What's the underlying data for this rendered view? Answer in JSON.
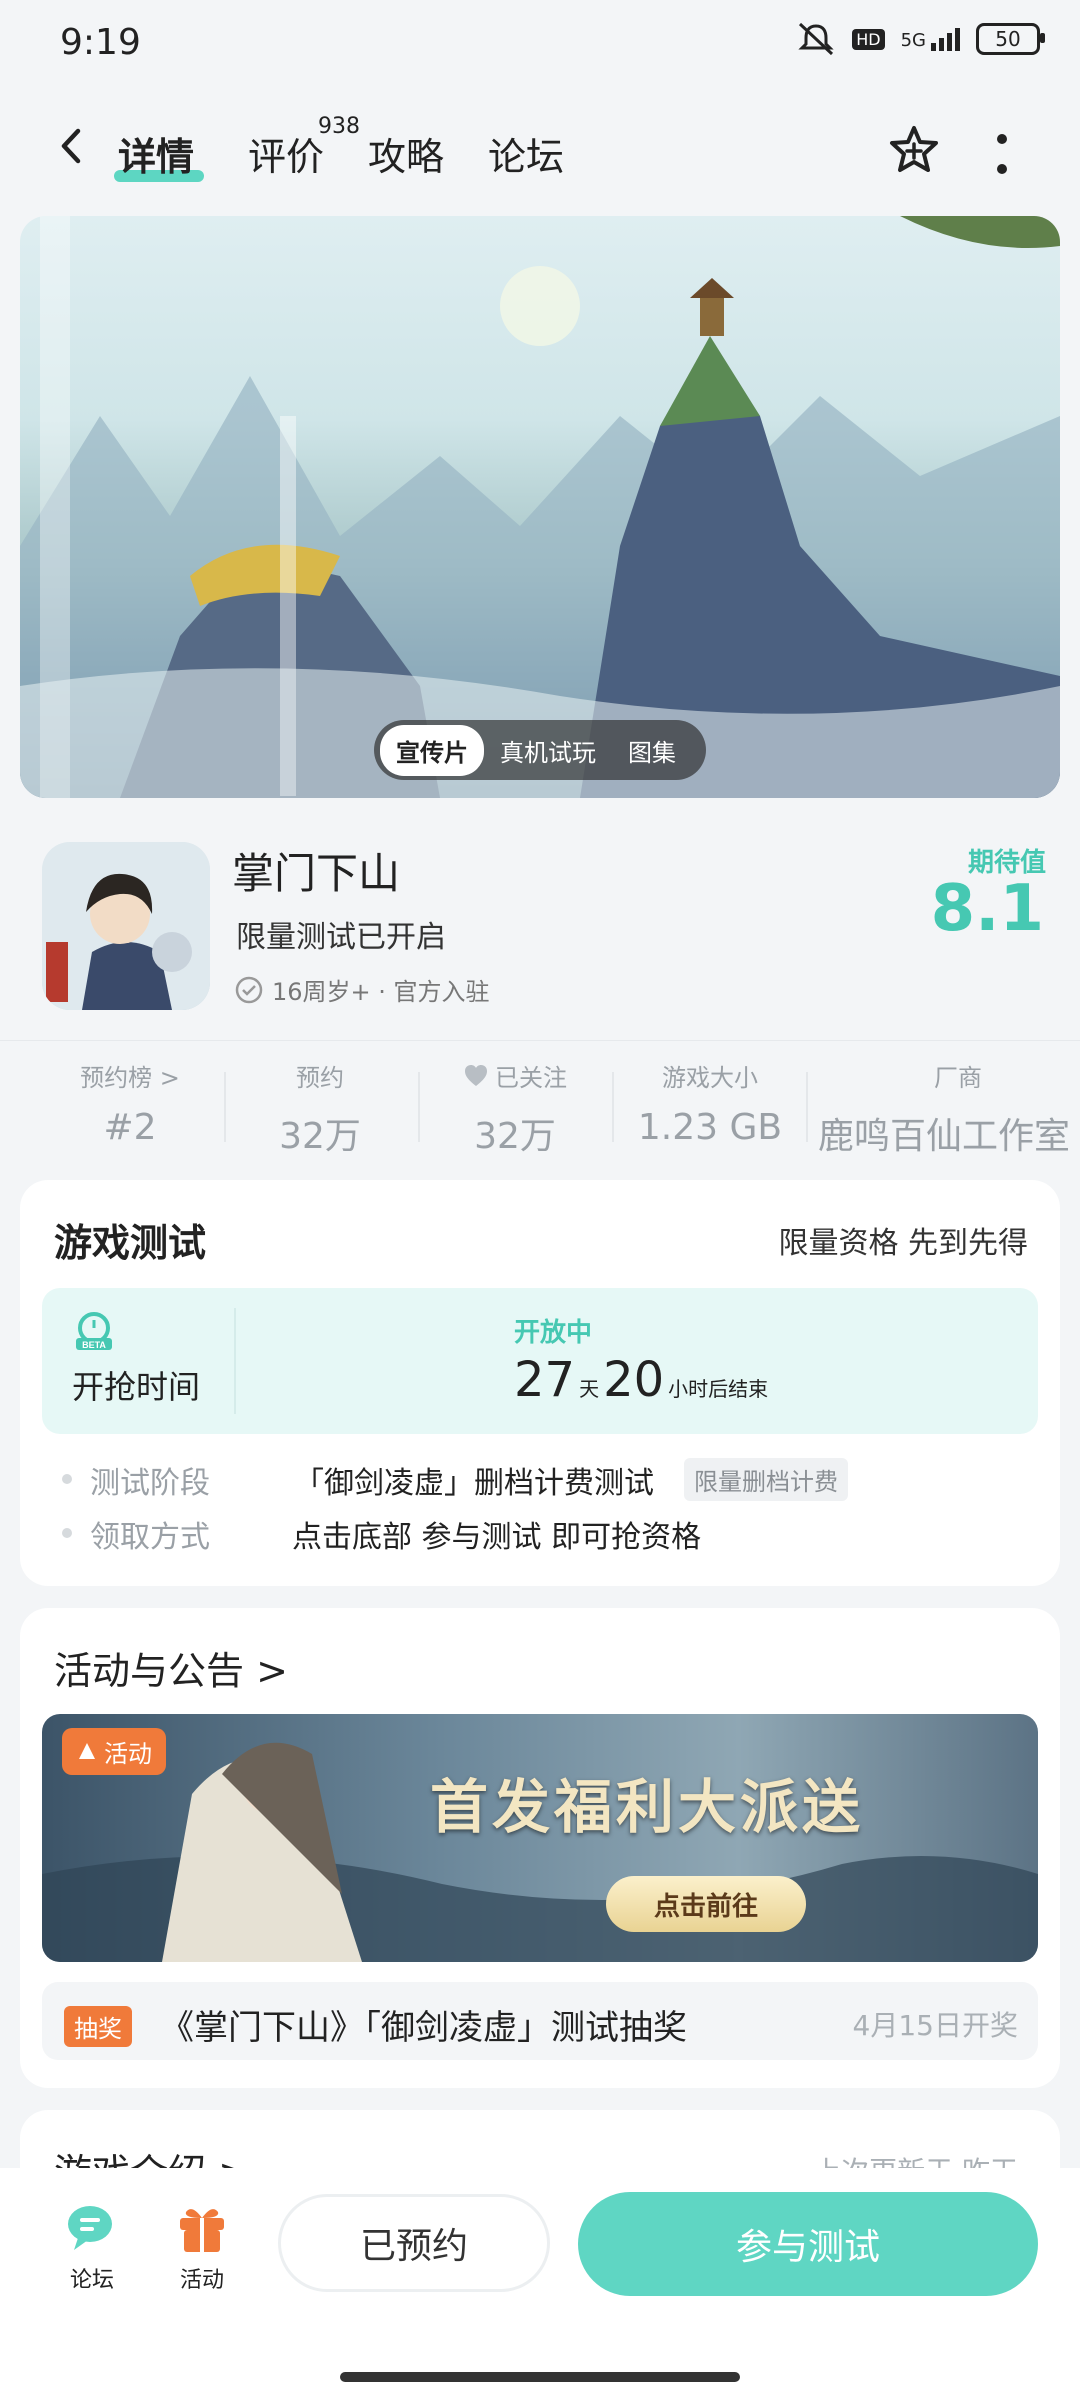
{
  "status_bar": {
    "time": "9:19",
    "network": "5G",
    "hd": "HD",
    "battery": "50"
  },
  "nav": {
    "tabs": [
      {
        "label": "详情",
        "active": true
      },
      {
        "label": "评价",
        "badge": "938"
      },
      {
        "label": "攻略"
      },
      {
        "label": "论坛"
      }
    ]
  },
  "hero": {
    "media_tabs": [
      "宣传片",
      "真机试玩",
      "图集"
    ],
    "active_media_tab": "宣传片"
  },
  "app": {
    "title": "掌门下山",
    "subtitle": "限量测试已开启",
    "age": "16周岁+ · 官方入驻",
    "expectation_label": "期待值",
    "expectation_value": "8.1"
  },
  "stats": [
    {
      "label": "预约榜 >",
      "value": "#2"
    },
    {
      "label": "预约",
      "value": "32万"
    },
    {
      "label": "已关注",
      "value": "32万"
    },
    {
      "label": "游戏大小",
      "value": "1.23 GB"
    },
    {
      "label": "厂商",
      "value": "鹿鸣百仙工作室"
    }
  ],
  "game_test": {
    "title": "游戏测试",
    "note": "限量资格 先到先得",
    "open_time_label": "开抢时间",
    "status": "开放中",
    "countdown_days": "27",
    "days_unit": "天",
    "countdown_hours": "20",
    "hours_suffix": "小时后结束",
    "rows": [
      {
        "label": "测试阶段",
        "value": "「御剑凌虚」删档计费测试",
        "tag": "限量删档计费"
      },
      {
        "label": "领取方式",
        "value": "点击底部 参与测试 即可抢资格"
      }
    ]
  },
  "activities": {
    "title": "活动与公告 >",
    "banner_badge": "活动",
    "banner_title": "首发福利大派送",
    "banner_button": "点击前往",
    "lottery_tag": "抽奖",
    "lottery_text": "《掌门下山》「御剑凌虚」测试抽奖",
    "lottery_date": "4月15日开奖"
  },
  "intro": {
    "title": "游戏介绍 >",
    "updated": "上次更新于 昨天"
  },
  "bottom_bar": {
    "forum_label": "论坛",
    "activity_label": "活动",
    "reserved_label": "已预约",
    "join_label": "参与测试"
  },
  "colors": {
    "accent": "#5fd6c3",
    "accent_text": "#46c8b2",
    "orange": "#f07a3a"
  }
}
